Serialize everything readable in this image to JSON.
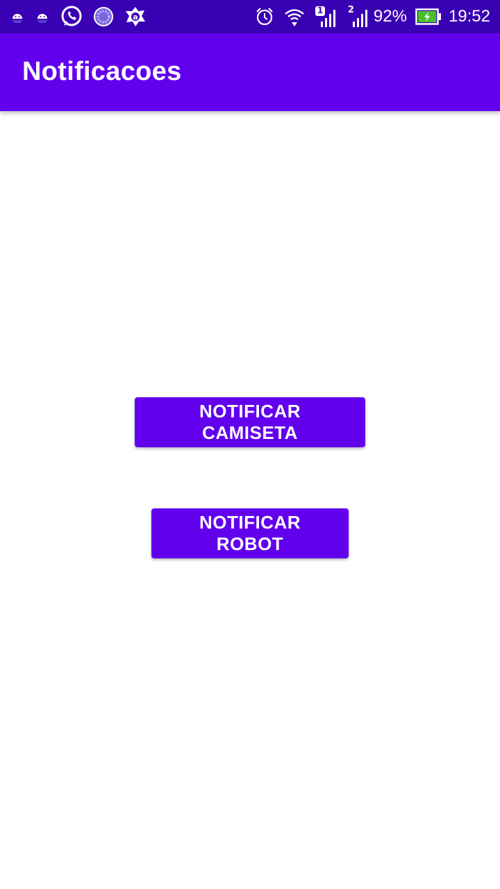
{
  "status_bar": {
    "left_icons": [
      "android-icon",
      "android-icon",
      "whatsapp-icon",
      "loading-circle-icon",
      "avast-icon"
    ],
    "sim1_label": "1",
    "sim2_label": "2",
    "battery_percent": "92%",
    "time": "19:52",
    "background_color": "#3a00b3"
  },
  "app_bar": {
    "title": "Notificacoes",
    "background_color": "#6200ee"
  },
  "buttons": {
    "camiseta_label": "NOTIFICAR CAMISETA",
    "robot_label": "NOTIFICAR ROBOT",
    "color": "#6200ee"
  }
}
